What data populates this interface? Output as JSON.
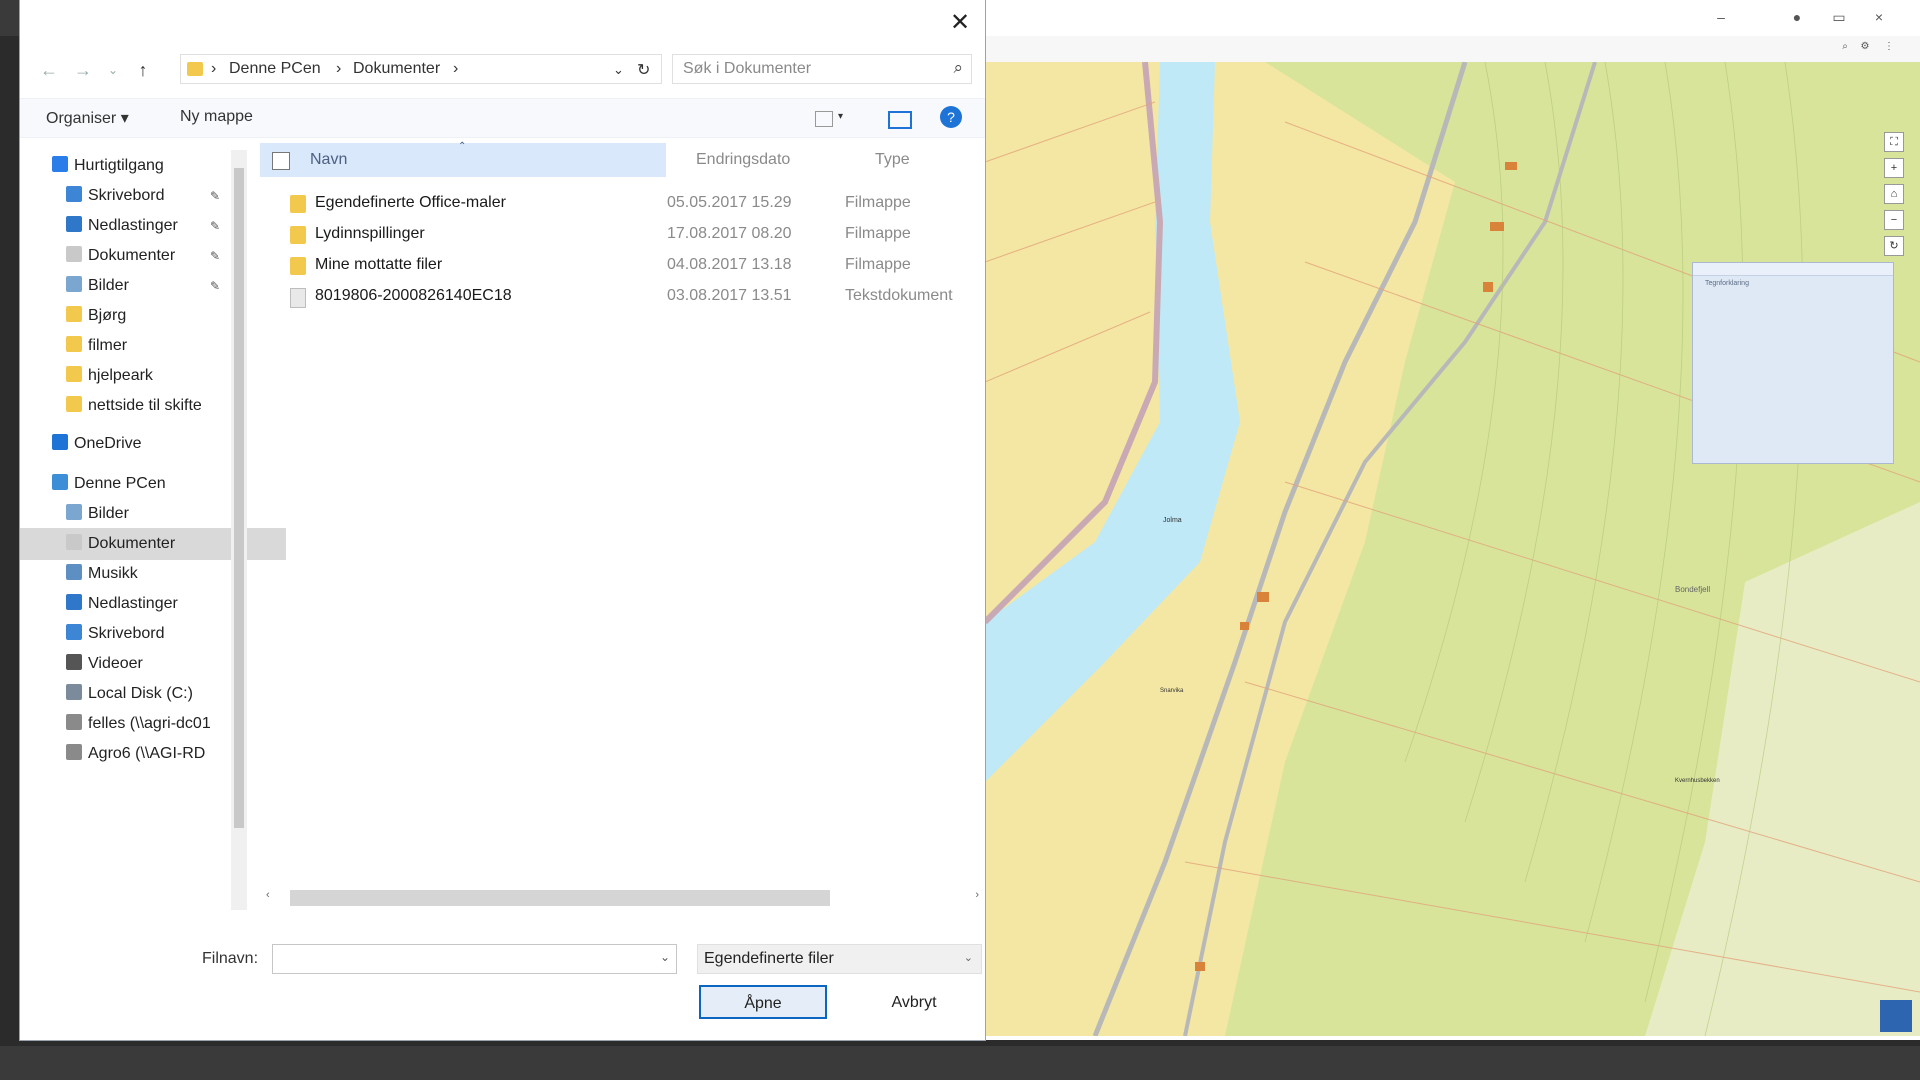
{
  "dialog": {
    "nav": {
      "back": "←",
      "forward": "→",
      "recent": "⌄",
      "up": "↑"
    },
    "breadcrumb": [
      "Denne PCen",
      "Dokumenter"
    ],
    "search_placeholder": "Søk i Dokumenter",
    "toolbar": {
      "organize": "Organiser ▾",
      "new_folder": "Ny mappe"
    },
    "nav_items": [
      {
        "label": "Hurtigtilgang",
        "color": "#2b7de9",
        "indent": 1,
        "pinned": false
      },
      {
        "label": "Skrivebord",
        "color": "#3d86d6",
        "indent": 2,
        "pinned": true
      },
      {
        "label": "Nedlastinger",
        "color": "#2f78c9",
        "indent": 2,
        "pinned": true
      },
      {
        "label": "Dokumenter",
        "color": "#c9c9c9",
        "indent": 2,
        "pinned": true
      },
      {
        "label": "Bilder",
        "color": "#7aa6cf",
        "indent": 2,
        "pinned": true
      },
      {
        "label": "Bjørg",
        "color": "#f2c94c",
        "indent": 2,
        "pinned": false
      },
      {
        "label": "filmer",
        "color": "#f2c94c",
        "indent": 2,
        "pinned": false
      },
      {
        "label": "hjelpeark",
        "color": "#f2c94c",
        "indent": 2,
        "pinned": false
      },
      {
        "label": "nettside til skifte",
        "color": "#f2c94c",
        "indent": 2,
        "pinned": false
      },
      {
        "label": "OneDrive",
        "color": "#1e74d6",
        "indent": 1,
        "pinned": false
      },
      {
        "label": "Denne PCen",
        "color": "#3c8fd6",
        "indent": 1,
        "pinned": false
      },
      {
        "label": "Bilder",
        "color": "#7aa6cf",
        "indent": 2,
        "pinned": false
      },
      {
        "label": "Dokumenter",
        "color": "#c9c9c9",
        "indent": 2,
        "pinned": false,
        "selected": true
      },
      {
        "label": "Musikk",
        "color": "#5e8fc2",
        "indent": 2,
        "pinned": false
      },
      {
        "label": "Nedlastinger",
        "color": "#2f78c9",
        "indent": 2,
        "pinned": false
      },
      {
        "label": "Skrivebord",
        "color": "#3d86d6",
        "indent": 2,
        "pinned": false
      },
      {
        "label": "Videoer",
        "color": "#555555",
        "indent": 2,
        "pinned": false
      },
      {
        "label": "Local Disk (C:)",
        "color": "#7b8b9b",
        "indent": 2,
        "pinned": false
      },
      {
        "label": "felles (\\\\agri-dc01",
        "color": "#8a8a8a",
        "indent": 2,
        "pinned": false
      },
      {
        "label": "Agro6 (\\\\AGI-RD",
        "color": "#8a8a8a",
        "indent": 2,
        "pinned": false
      }
    ],
    "columns": {
      "name": "Navn",
      "date": "Endringsdato",
      "type": "Type"
    },
    "files": [
      {
        "name": "Egendefinerte Office-maler",
        "date": "05.05.2017 15.29",
        "type": "Filmappe",
        "kind": "folder"
      },
      {
        "name": "Lydinnspillinger",
        "date": "17.08.2017 08.20",
        "type": "Filmappe",
        "kind": "folder"
      },
      {
        "name": "Mine mottatte filer",
        "date": "04.08.2017 13.18",
        "type": "Filmappe",
        "kind": "folder"
      },
      {
        "name": "8019806-2000826140EC18",
        "date": "03.08.2017 13.51",
        "type": "Tekstdokument",
        "kind": "doc"
      }
    ],
    "filename_label": "Filnavn:",
    "filename_value": "",
    "filetype": "Egendefinerte filer",
    "open_label": "Åpne",
    "cancel_label": "Avbryt",
    "close_glyph": "✕"
  },
  "map": {
    "panel_title": "Tegnforklaring",
    "labels": [
      "Jolma",
      "Bondefjell",
      "Snarvika",
      "Kvernhusbekken"
    ],
    "water_color": "#bfe9f7",
    "farmland_color": "#f3e7a3",
    "forest_color": "#d7e49a"
  }
}
